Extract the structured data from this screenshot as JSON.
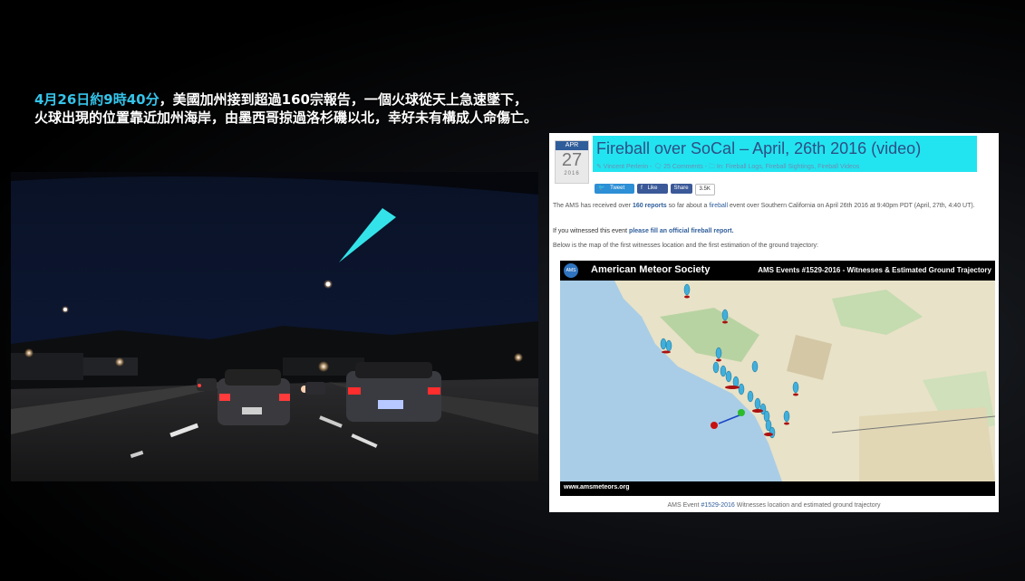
{
  "caption": {
    "highlight": "4月26日約9時40分",
    "line1_rest": "，美國加州接到超過160宗報告，一個火球從天上急速墜下，",
    "line2": "火球出現的位置靠近加州海岸，由墨西哥掠過洛杉磯以北，幸好未有構成人命傷亡。"
  },
  "article": {
    "date": {
      "month": "APR",
      "day": "27",
      "year": "2016"
    },
    "title": "Fireball over SoCal – April, 26th 2016 (video)",
    "meta": "✎ Vincent Perlerin - 🗨 25 Comments - 🗀 In: Fireball Logs, Fireball Sightings, Fireball Videos",
    "share": {
      "tweet": "Tweet",
      "like": "Like",
      "share": "Share",
      "count": "3.5K"
    },
    "p1_a": "The AMS has received over ",
    "p1_link": "160 reports",
    "p1_b": " so far about a ",
    "p1_link2": "fireball",
    "p1_c": " event over Southern California on April 26th 2016 at 9:40pm PDT (April, 27th, 4:40 UT).",
    "p2_a": "If you witnessed this event ",
    "p2_link": "please fill an official fireball report.",
    "p3": "Below is the map of the first witnesses location and the first estimation of the ground trajectory:",
    "map": {
      "logo": "AMS",
      "org": "American Meteor Society",
      "events": "AMS Events #1529-2016 - Witnesses & Estimated Ground Trajectory",
      "url": "www.amsmeteors.org"
    },
    "caption_a": "AMS Event ",
    "caption_link": "#1529-2016",
    "caption_b": " Witnesses location and estimated ground trajectory"
  },
  "colors": {
    "title_bg": "#22e4f0",
    "title_text": "#2e4f84",
    "caption_highlight": "#35c4ea",
    "fireball": "#34e3ea"
  }
}
